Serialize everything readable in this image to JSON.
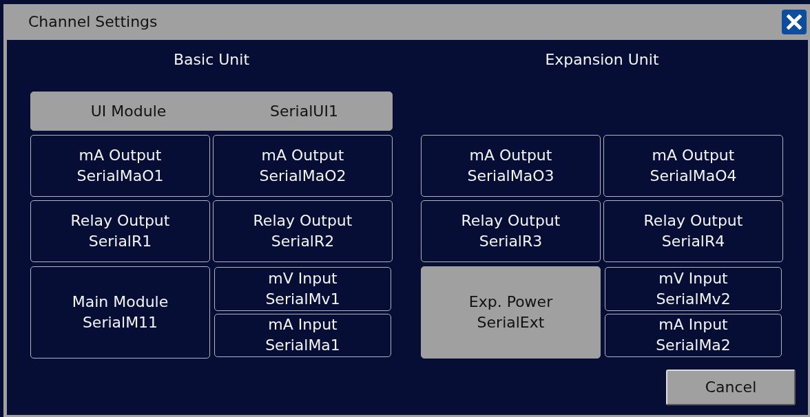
{
  "window": {
    "title": "Channel Settings"
  },
  "units": [
    {
      "title": "Basic Unit",
      "header": {
        "label": "UI Module",
        "serial": "SerialUI1",
        "disabled": true
      },
      "rows": [
        [
          {
            "kind": "tile",
            "label": "mA Output",
            "serial": "SerialMaO1",
            "disabled": false
          },
          {
            "kind": "tile",
            "label": "mA Output",
            "serial": "SerialMaO2",
            "disabled": false
          }
        ],
        [
          {
            "kind": "tile",
            "label": "Relay Output",
            "serial": "SerialR1",
            "disabled": false
          },
          {
            "kind": "tile",
            "label": "Relay Output",
            "serial": "SerialR2",
            "disabled": false
          }
        ],
        [
          {
            "kind": "tile",
            "label": "Main Module",
            "serial": "SerialM11",
            "disabled": false
          },
          {
            "kind": "stack",
            "items": [
              {
                "label": "mV Input",
                "serial": "SerialMv1",
                "disabled": false
              },
              {
                "label": "mA Input",
                "serial": "SerialMa1",
                "disabled": false
              }
            ]
          }
        ]
      ]
    },
    {
      "title": "Expansion Unit",
      "rows": [
        [
          {
            "kind": "tile",
            "label": "mA Output",
            "serial": "SerialMaO3",
            "disabled": false
          },
          {
            "kind": "tile",
            "label": "mA Output",
            "serial": "SerialMaO4",
            "disabled": false
          }
        ],
        [
          {
            "kind": "tile",
            "label": "Relay Output",
            "serial": "SerialR3",
            "disabled": false
          },
          {
            "kind": "tile",
            "label": "Relay Output",
            "serial": "SerialR4",
            "disabled": false
          }
        ],
        [
          {
            "kind": "tile",
            "label": "Exp. Power",
            "serial": "SerialExt",
            "disabled": true
          },
          {
            "kind": "stack",
            "items": [
              {
                "label": "mV Input",
                "serial": "SerialMv2",
                "disabled": false
              },
              {
                "label": "mA Input",
                "serial": "SerialMa2",
                "disabled": false
              }
            ]
          }
        ]
      ]
    }
  ],
  "buttons": [
    "Cancel"
  ]
}
